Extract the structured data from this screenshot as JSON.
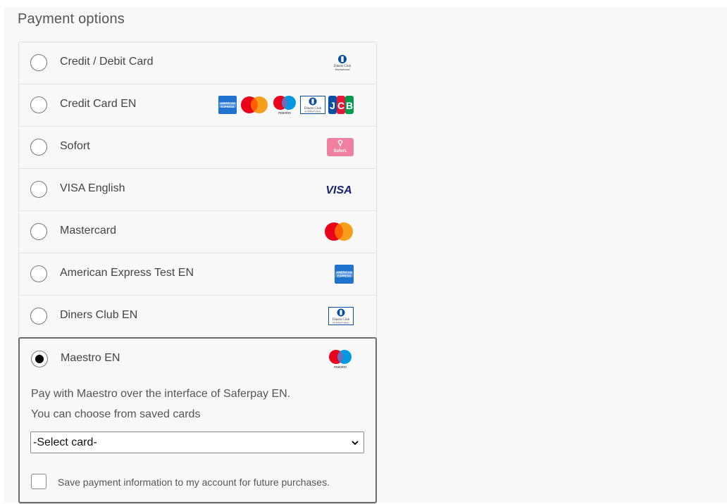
{
  "section_title": "Payment options",
  "options": [
    {
      "label": "Credit / Debit Card",
      "logos": [
        "diners-logo-small"
      ]
    },
    {
      "label": "Credit Card EN",
      "logos": [
        "amex-logo",
        "mastercard-logo",
        "maestro-logo",
        "diners-logo",
        "jcb-logo"
      ]
    },
    {
      "label": "Sofort",
      "logos": [
        "sofort-logo"
      ]
    },
    {
      "label": "VISA English",
      "logos": [
        "visa-logo"
      ]
    },
    {
      "label": "Mastercard",
      "logos": [
        "mastercard-logo"
      ]
    },
    {
      "label": "American Express Test EN",
      "logos": [
        "amex-logo"
      ]
    },
    {
      "label": "Diners Club EN",
      "logos": [
        "diners-logo"
      ]
    },
    {
      "label": "Maestro EN",
      "logos": [
        "maestro-logo"
      ],
      "selected": true
    }
  ],
  "selected_detail": {
    "line1": "Pay with Maestro over the interface of Saferpay EN.",
    "line2": "You can choose from saved cards",
    "select_value": "-Select card-",
    "save_label": "Save payment information to my account for future purchases."
  },
  "logo_text": {
    "visa": "VISA",
    "sofort": "Sofort.",
    "amex": "AMERICAN EXPRESS",
    "diners": "Diners Club",
    "diners_small": "Diners Club International",
    "maestro": "maestro",
    "jcb": "JCB"
  },
  "colors": {
    "mc_red": "#eb001b",
    "mc_orange": "#f79e1b",
    "maestro_blue": "#0099df",
    "amex_blue": "#1f72cd",
    "visa_blue": "#1a1f71",
    "sofort_pink": "#ef809f",
    "selected_border": "#6b6b6b"
  }
}
